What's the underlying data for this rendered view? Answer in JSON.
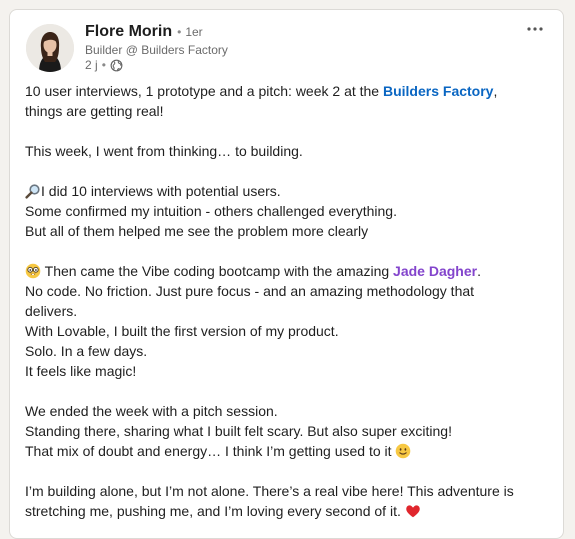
{
  "author": {
    "name": "Flore Morin",
    "separator": "•",
    "degree": "1er",
    "headline": "Builder @ Builders Factory",
    "time": "2 j",
    "meta_separator": "•",
    "visibility_icon": "globe-icon",
    "avatar_icon": "profile-photo"
  },
  "menu": {
    "icon": "more-options-icon"
  },
  "post": {
    "p1_before": "10 user interviews, 1 prototype and a pitch: week 2 at the ",
    "p1_link": "Builders Factory",
    "p1_after": ",",
    "p1_line2": "things are getting real!",
    "p2": "This week, I went from thinking… to building.",
    "p3_l1": "I did 10 interviews with potential users.",
    "p3_l1_icon": "magnifier-icon",
    "p3_l2": "Some confirmed my intuition - others challenged everything.",
    "p3_l3": "But all of them helped me see the problem more clearly",
    "p4_icon": "nerd-face-icon",
    "p4_l1_before": " Then came the Vibe coding bootcamp with the amazing ",
    "p4_link": "Jade Dagher",
    "p4_l1_after": ".",
    "p4_l2": "No code. No friction. Just pure focus - and an amazing methodology that",
    "p4_l3": "delivers.",
    "p4_l4": "With Lovable, I built the first version of my product.",
    "p4_l5": "Solo. In a few days.",
    "p4_l6": "It feels like magic!",
    "p5_l1": "We ended the week with a pitch session.",
    "p5_l2": "Standing there, sharing what I built felt scary. But also super exciting!",
    "p5_l3": "That mix of doubt and energy… I think I’m getting used to it ",
    "p5_icon": "slightly-smiling-face-icon",
    "p6_l1": "I’m building alone, but I’m not alone. There’s a real vibe here! This adventure is",
    "p6_l2": "stretching me, pushing me, and I’m loving every second of it. ",
    "p6_icon": "red-heart-icon"
  },
  "colors": {
    "link_company": "#0a66c2",
    "link_person": "#8344cc",
    "text": "#1f1f1f",
    "muted": "#6b6b6b"
  }
}
